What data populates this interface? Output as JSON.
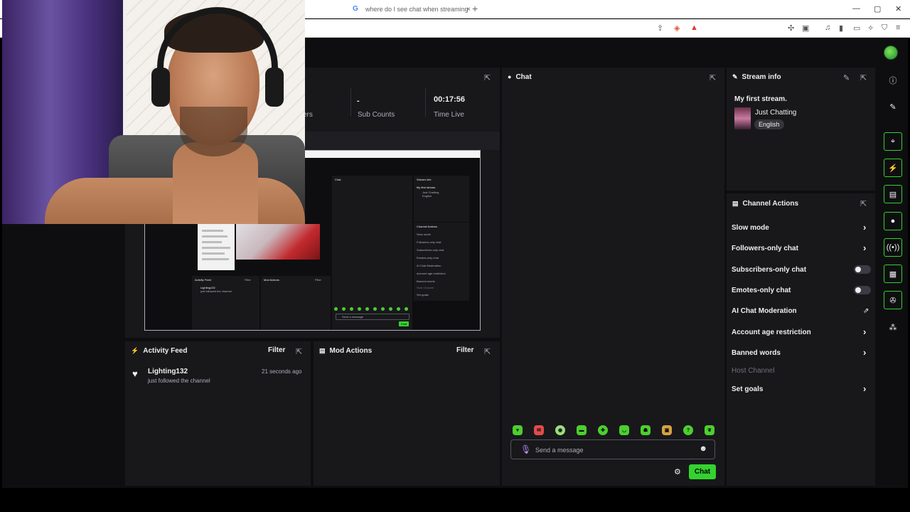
{
  "browser": {
    "tab_title": "where do I see chat when streaming",
    "tab_close": "×",
    "new_tab": "+",
    "window": {
      "minimize": "—",
      "maximize": "▢",
      "close": "✕"
    }
  },
  "stats": {
    "partial_label": "ers",
    "sub_value": "-",
    "sub_label": "Sub Counts",
    "time_value": "00:17:56",
    "time_label": "Time Live"
  },
  "preview_mini": {
    "chat_label": "Chat",
    "stream_info_label": "Stream info",
    "first_stream": "My first stream.",
    "category": "Just Chatting",
    "lang": "English",
    "channel_actions": "Channel Actions",
    "items": [
      "Slow mode",
      "Followers-only chat",
      "Subscribers-only chat",
      "Emotes-only chat",
      "AI Chat Moderation",
      "Account age restriction",
      "Banned words",
      "Host Channel",
      "Set goals"
    ],
    "activity_feed": "Activity Feed",
    "mod_actions": "Mod Actions",
    "filter": "Filter",
    "feed_user": "Lighting132",
    "feed_sub": "just followed the channel",
    "send": "Send a message",
    "chat_btn": "Chat"
  },
  "activity_feed": {
    "title": "Activity Feed",
    "filter": "Filter",
    "items": [
      {
        "user": "Lighting132",
        "text": "just followed the channel",
        "time": "21 seconds ago"
      }
    ]
  },
  "mod_actions": {
    "title": "Mod Actions",
    "filter": "Filter"
  },
  "chat": {
    "title": "Chat",
    "placeholder": "Send a message",
    "send_label": "Chat",
    "emote_count": 10
  },
  "stream_info": {
    "title": "Stream info",
    "stream_title": "My first stream.",
    "category": "Just Chatting",
    "tag": "English"
  },
  "channel_actions": {
    "title": "Channel Actions",
    "items": [
      {
        "label": "Slow mode",
        "control": "chevron"
      },
      {
        "label": "Followers-only chat",
        "control": "chevron"
      },
      {
        "label": "Subscribers-only chat",
        "control": "toggle"
      },
      {
        "label": "Emotes-only chat",
        "control": "toggle"
      },
      {
        "label": "AI Chat Moderation",
        "control": "external"
      },
      {
        "label": "Account age restriction",
        "control": "chevron"
      },
      {
        "label": "Banned words",
        "control": "chevron"
      },
      {
        "label": "Host Channel",
        "control": "none",
        "disabled": true
      },
      {
        "label": "Set goals",
        "control": "chevron"
      }
    ]
  },
  "colors": {
    "accent": "#34d22f",
    "bg": "#0e0e10",
    "panel": "#18181b",
    "muted": "#adadb8"
  }
}
